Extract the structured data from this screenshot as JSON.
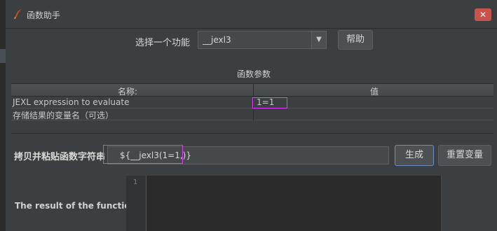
{
  "window": {
    "title": "函数助手",
    "close_label": "✕"
  },
  "selector": {
    "label": "选择一个功能",
    "value": "__jexl3",
    "help_label": "帮助"
  },
  "params": {
    "title": "函数参数",
    "columns": [
      "名称:",
      "值"
    ],
    "rows": [
      {
        "name": "JEXL expression to evaluate",
        "value": "1=1"
      },
      {
        "name": "存储结果的变量名（可选）",
        "value": ""
      }
    ]
  },
  "copy_string": {
    "label": "拷贝并粘贴函数字符串",
    "value": "${__jexl3(1=1,)}",
    "generate_label": "生成",
    "reset_label": "重置变量"
  },
  "result": {
    "label": "The result of the function is",
    "line_number": "1"
  },
  "colors": {
    "highlight": "#e040fb",
    "background": "#3c3f41"
  }
}
